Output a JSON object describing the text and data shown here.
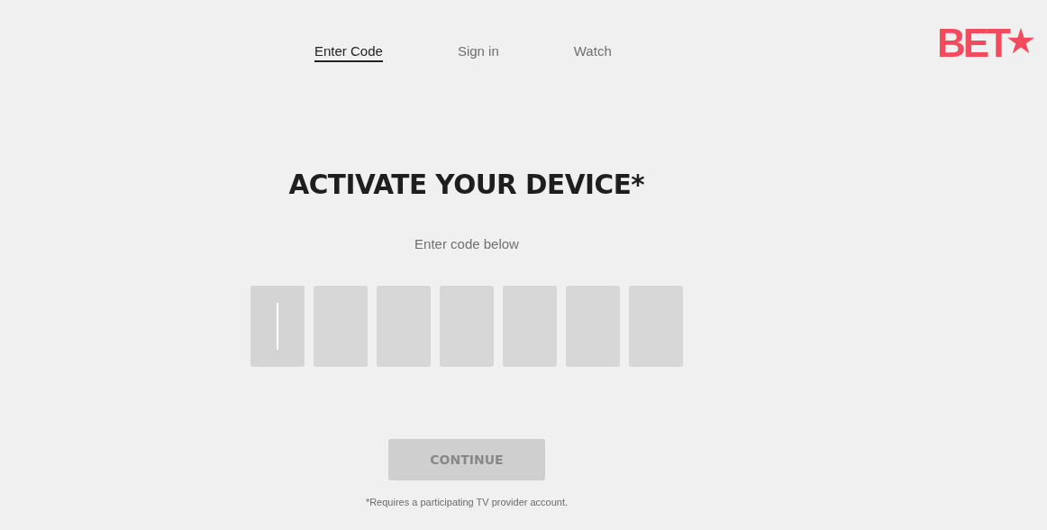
{
  "nav": {
    "tabs": [
      {
        "label": "Enter Code",
        "selected": true
      },
      {
        "label": "Sign in",
        "selected": false
      },
      {
        "label": "Watch",
        "selected": false
      }
    ]
  },
  "logo": {
    "text": "BET"
  },
  "title": "ACTIVATE YOUR DEVICE*",
  "subtitle": "Enter code below",
  "code_boxes": [
    {
      "focused": true
    },
    {
      "focused": false
    },
    {
      "focused": false
    },
    {
      "focused": false
    },
    {
      "focused": false
    },
    {
      "focused": false
    },
    {
      "focused": false
    }
  ],
  "continue_button": {
    "label": "CONTINUE",
    "disabled": true
  },
  "footnote": "*Requires a participating TV provider account."
}
